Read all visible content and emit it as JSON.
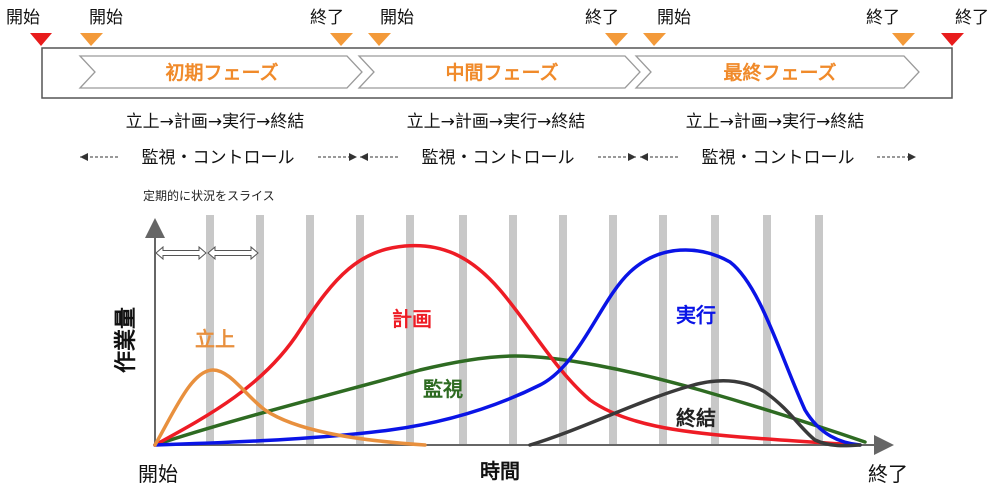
{
  "top_markers": {
    "project_start": "開始",
    "project_end": "終了",
    "phase_start": "開始",
    "phase_end": "終了"
  },
  "phases": [
    {
      "label": "初期フェーズ",
      "steps": "立上→計画→実行→終結"
    },
    {
      "label": "中間フェーズ",
      "steps": "立上→計画→実行→終結"
    },
    {
      "label": "最終フェーズ",
      "steps": "立上→計画→実行→終結"
    }
  ],
  "monitoring_label": "監視・コントロール",
  "slice_note": "定期的に状況をスライス",
  "axes": {
    "y_label": "作業量",
    "x_label": "時間",
    "x_start": "開始",
    "x_end": "終了"
  },
  "curves": [
    {
      "name": "立上",
      "color": "#e8903e"
    },
    {
      "name": "計画",
      "color": "#ee1c25"
    },
    {
      "name": "監視",
      "color": "#2e6b22"
    },
    {
      "name": "実行",
      "color": "#0a14e6"
    },
    {
      "name": "終結",
      "color": "#3a3a3a"
    }
  ],
  "colors": {
    "accent_orange": "#f39a3a",
    "marker_red": "#e81c1c",
    "phase_text": "#f08a2a",
    "slice_bar": "#c2c2c2"
  }
}
